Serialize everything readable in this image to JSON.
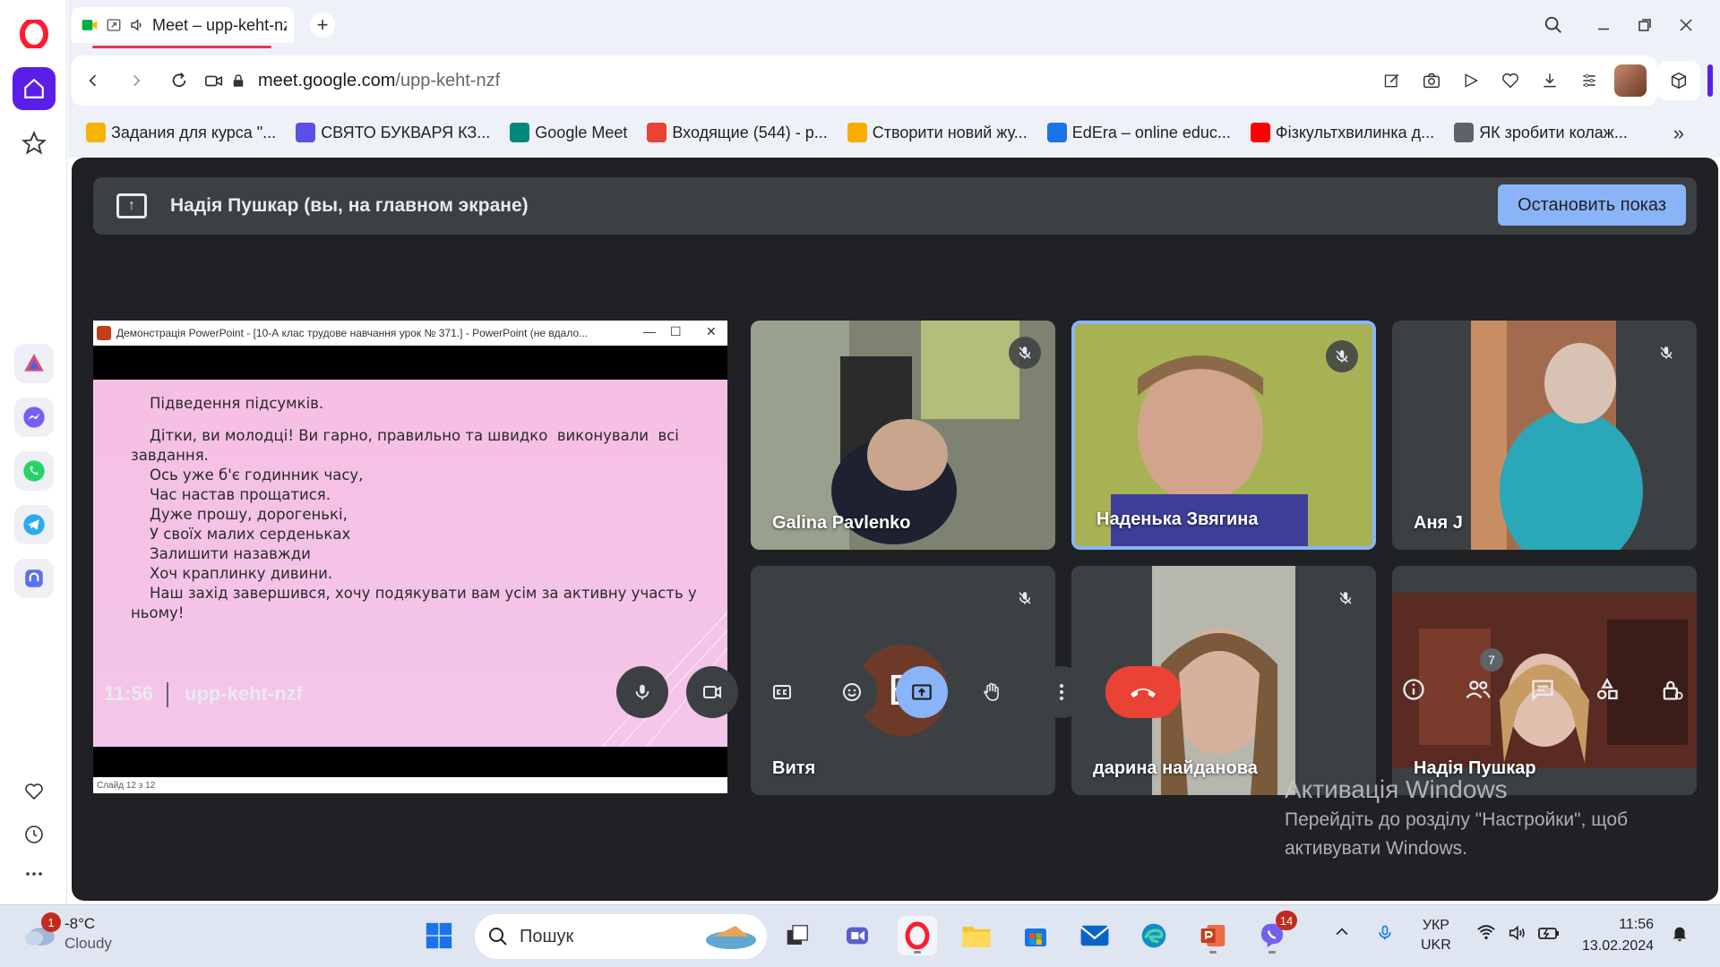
{
  "browser": {
    "tab_title": "Meet – upp-keht-nzf",
    "url_host": "meet.google.com",
    "url_path": "/upp-keht-nzf",
    "bookmarks": [
      {
        "label": "Задания для курса \"...",
        "icon": "classroom-icon",
        "color": "#f4b400"
      },
      {
        "label": "СВЯТО БУКВАРЯ КЗ...",
        "icon": "heart-icon",
        "color": "#5b4fe6"
      },
      {
        "label": "Google Meet",
        "icon": "meet-icon",
        "color": "#00897b"
      },
      {
        "label": "Входящие (544) - p...",
        "icon": "gmail-icon",
        "color": "#ea4335"
      },
      {
        "label": "Створити новий жу...",
        "icon": "sun-icon",
        "color": "#f9ab00"
      },
      {
        "label": "EdEra – online educ...",
        "icon": "edera-icon",
        "color": "#1a73e8"
      },
      {
        "label": "Фізкультхвилинка д...",
        "icon": "youtube-icon",
        "color": "#ff0000"
      },
      {
        "label": "ЯК зробити колаж...",
        "icon": "file-icon",
        "color": "#5f6368"
      }
    ]
  },
  "meet": {
    "banner_text": "Надія Пушкар (вы, на главном экране)",
    "stop_label": "Остановить показ",
    "time": "11:56",
    "meeting_code": "upp-keht-nzf",
    "participants_badge": "7",
    "presentation": {
      "window_title": "Демонстрація PowerPoint - [10-А клас трудове навчання урок № 371.] - PowerPoint (не вдало...",
      "status": "Слайд 12 з 12",
      "lines": [
        "    Підведення підсумків.",
        "",
        "    Дітки, ви молодці! Ви гарно, правильно та швидко  виконували  всі",
        "завдання.",
        "    Ось уже б'є годинник часу,",
        "    Час настав прощатися.",
        "    Дуже прошу, дорогенькі,",
        "    У своїх малих серденьках",
        "    Залишити назавжди",
        "    Хоч краплинку дивини.",
        "    Наш захід завершився, хочу подякувати вам усім за активну участь у",
        "ньому!"
      ]
    },
    "tiles": [
      {
        "name": "Galina Pavlenko"
      },
      {
        "name": "Наденька Звягина"
      },
      {
        "name": "Аня J"
      },
      {
        "name": "Витя",
        "initial": "В"
      },
      {
        "name": "дарина найданова"
      },
      {
        "name": "Надія Пушкар"
      }
    ],
    "activation_title": "Активація Windows",
    "activation_line1": "Перейдіть до розділу \"Настройки\", щоб",
    "activation_line2": "активувати Windows."
  },
  "taskbar": {
    "weather_badge": "1",
    "temperature": "-8°C",
    "condition": "Cloudy",
    "search_placeholder": "Пошук",
    "viber_badge": "14",
    "lang_top": "УКР",
    "lang_bottom": "UKR",
    "clock_time": "11:56",
    "clock_date": "13.02.2024"
  }
}
